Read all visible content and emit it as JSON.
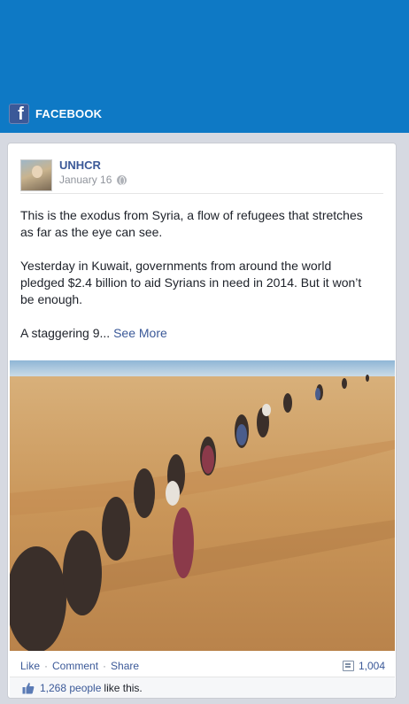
{
  "header": {
    "brand_label": "FACEBOOK",
    "brand_icon": "facebook-f-icon",
    "background_color": "#0e79c5"
  },
  "post": {
    "page_name": "UNHCR",
    "date": "January 16",
    "paragraphs": [
      "This is the exodus from Syria, a flow of refugees that stretches as far as the eye can see.",
      "Yesterday in Kuwait, governments from around the world pledged $2.4 billion to aid Syrians in need in 2014. But it won’t be enough."
    ],
    "truncated_text": "A staggering 9...",
    "see_more_label": "See More",
    "photo_icon": "refugees-desert-photo"
  },
  "actions": {
    "like_label": "Like",
    "comment_label": "Comment",
    "share_label": "Share",
    "separator": "·",
    "comment_count": "1,004"
  },
  "likes": {
    "count_label": "1,268 people",
    "suffix": "like this."
  }
}
